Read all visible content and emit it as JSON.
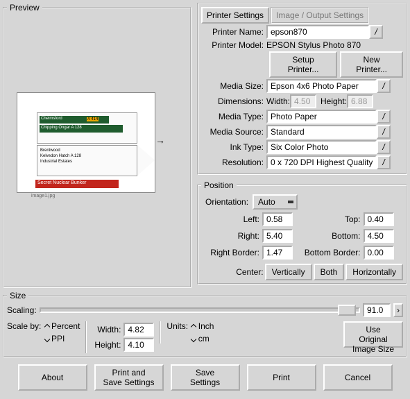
{
  "preview": {
    "legend": "Preview",
    "redbar": "Secret Nuclear Bunker",
    "green1": "Chelmsford",
    "green2": "Chipping Ongar  A 128",
    "yellow": "A 414",
    "whitetext": "Brentwood\nKelvedon Hatch  A 128\nIndustrial Estates"
  },
  "tabs": {
    "printer": "Printer Settings",
    "image": "Image / Output Settings"
  },
  "printer": {
    "name_label": "Printer Name:",
    "name": "epson870",
    "model_label": "Printer Model:",
    "model": "EPSON Stylus Photo 870",
    "setup_btn": "Setup Printer...",
    "new_btn": "New Printer...",
    "media_size_label": "Media Size:",
    "media_size": "Epson 4x6 Photo Paper",
    "dim_label": "Dimensions:",
    "w_label": "Width:",
    "w": "4.50",
    "h_label": "Height:",
    "h": "6.88",
    "media_type_label": "Media Type:",
    "media_type": "Photo Paper",
    "media_source_label": "Media Source:",
    "media_source": "Standard",
    "ink_label": "Ink Type:",
    "ink": "Six Color Photo",
    "res_label": "Resolution:",
    "res": "0 x 720 DPI Highest Quality"
  },
  "position": {
    "legend": "Position",
    "orientation_label": "Orientation:",
    "orientation": "Auto",
    "left_label": "Left:",
    "left": "0.58",
    "top_label": "Top:",
    "top": "0.40",
    "right_label": "Right:",
    "right": "5.40",
    "bottom_label": "Bottom:",
    "bottom": "4.50",
    "right_border_label": "Right Border:",
    "right_border": "1.47",
    "bottom_border_label": "Bottom Border:",
    "bottom_border": "0.00",
    "center_label": "Center:",
    "vert": "Vertically",
    "both": "Both",
    "horiz": "Horizontally"
  },
  "size": {
    "legend": "Size",
    "scaling_label": "Scaling:",
    "scaling": "91.0",
    "scale_by_label": "Scale by:",
    "percent": "Percent",
    "ppi": "PPI",
    "width_label": "Width:",
    "width": "4.82",
    "height_label": "Height:",
    "height": "4.10",
    "units_label": "Units:",
    "inch": "Inch",
    "cm": "cm",
    "use_original": "Use Original\nImage Size"
  },
  "buttons": {
    "about": "About",
    "print_save": "Print and\nSave Settings",
    "save": "Save\nSettings",
    "print": "Print",
    "cancel": "Cancel"
  }
}
